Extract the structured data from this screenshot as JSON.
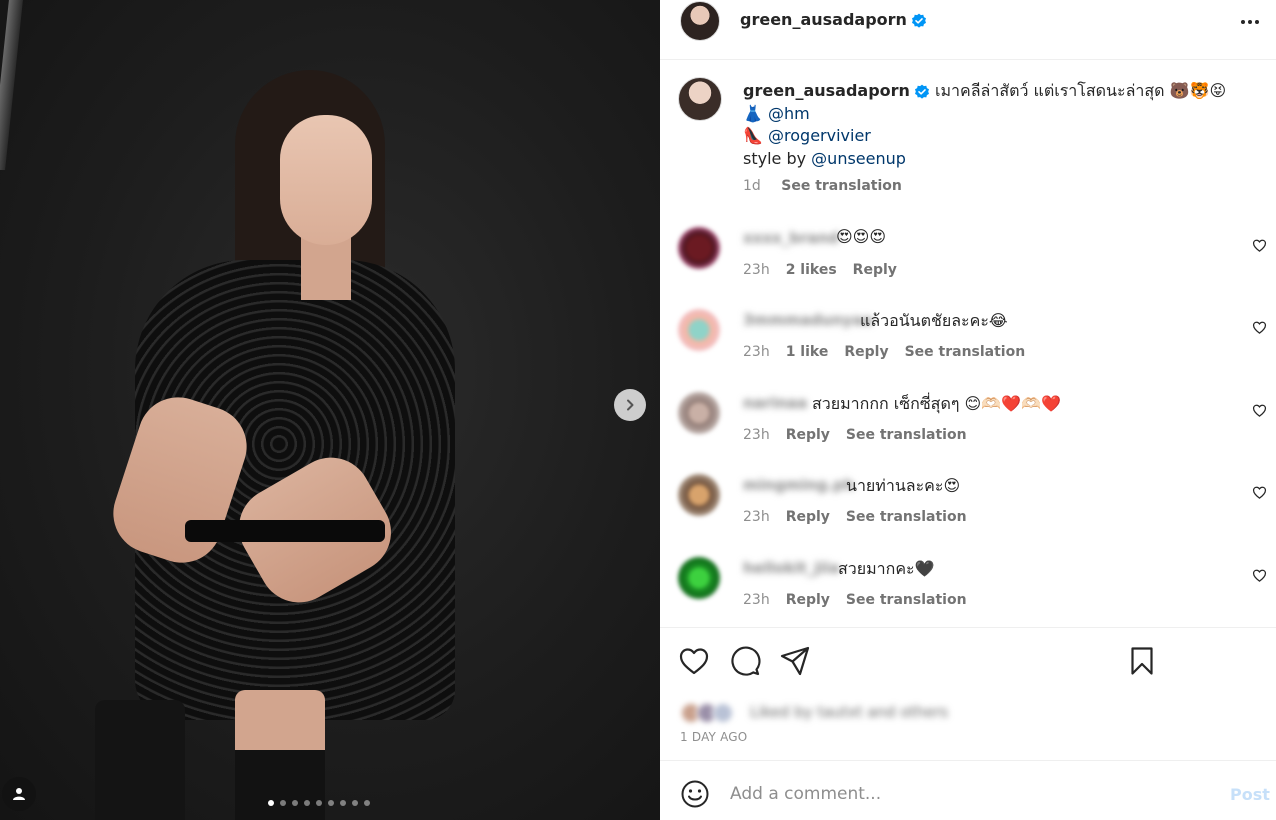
{
  "header": {
    "username": "green_ausadaporn",
    "verified": true
  },
  "caption": {
    "username": "green_ausadaporn",
    "line1": "เมาคลีล่าสัตว์ แต่เราโสดนะล่าสุด 🐻🐯😝",
    "line2_icon": "👗",
    "line2_mention": "@hm",
    "line3_icon": "👠",
    "line3_mention": "@rogervivier",
    "line4_prefix": "style by ",
    "line4_mention": "@unseenup",
    "time": "1d",
    "see_translation": "See translation"
  },
  "comments": [
    {
      "user": "xxxx_brand",
      "text": "😍😍😍",
      "time": "23h",
      "likes": "2 likes",
      "reply": "Reply",
      "translate": ""
    },
    {
      "user": "3mmmadunyaa",
      "text": "แล้วอนันตชัยละคะ😂",
      "time": "23h",
      "likes": "1 like",
      "reply": "Reply",
      "translate": "See translation"
    },
    {
      "user": "narinaa",
      "text": "สวยมากกก เซ็กซี่สุดๆ 😊🫶🏻❤️🫶🏻❤️",
      "time": "23h",
      "likes": "",
      "reply": "Reply",
      "translate": "See translation"
    },
    {
      "user": "mingming.ph",
      "text": "นายท่านละคะ😍",
      "time": "23h",
      "likes": "",
      "reply": "Reply",
      "translate": "See translation"
    },
    {
      "user": "hellokit_jiia",
      "text": "สวยมากคะ🖤",
      "time": "23h",
      "likes": "",
      "reply": "Reply",
      "translate": "See translation"
    }
  ],
  "liked_by": "Liked by tautxt and others",
  "time_ago": "1 DAY AGO",
  "add_comment": {
    "placeholder": "Add a comment...",
    "post_label": "Post"
  },
  "carousel": {
    "slide_count": 9,
    "active_index": 0
  },
  "colors": {
    "verified": "#0095f6",
    "mention": "#00376b",
    "post_disabled": "#c7e0f9"
  },
  "icons": [
    "verified-badge-icon",
    "more-options-icon",
    "chevron-right-icon",
    "user-tag-icon",
    "heart-icon",
    "comment-icon",
    "share-icon",
    "bookmark-icon",
    "emoji-icon"
  ]
}
